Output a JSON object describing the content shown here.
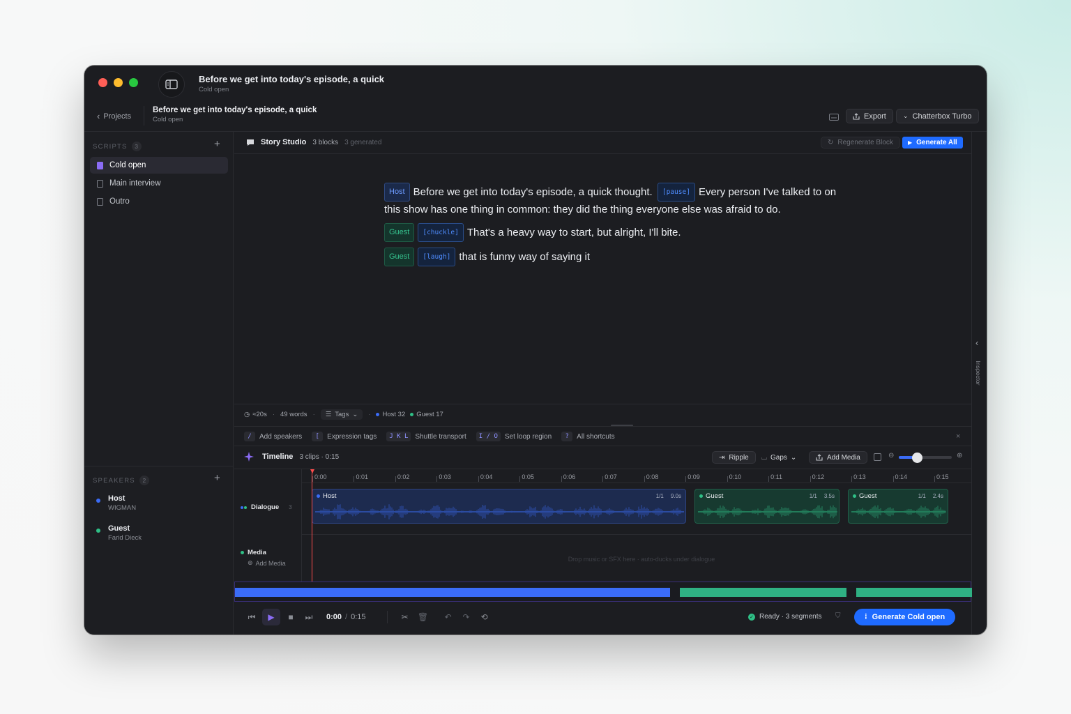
{
  "window": {
    "title": "Before we get into today's episode, a quick",
    "subtitle": "Cold open"
  },
  "header": {
    "back_label": "Projects",
    "title": "Before we get into today's episode, a quick",
    "subtitle": "Cold open",
    "export_label": "Export",
    "model_label": "Chatterbox Turbo"
  },
  "sidebar": {
    "scripts_label": "SCRIPTS",
    "scripts_count": "3",
    "scripts": [
      {
        "label": "Cold open"
      },
      {
        "label": "Main interview"
      },
      {
        "label": "Outro"
      }
    ],
    "speakers_label": "SPEAKERS",
    "speakers_count": "2",
    "speakers": [
      {
        "name": "Host",
        "voice": "WIGMAN",
        "color": "#3b6cf6"
      },
      {
        "name": "Guest",
        "voice": "Farid Dieck",
        "color": "#2fbf86"
      }
    ]
  },
  "studio": {
    "title": "Story Studio",
    "blocks": "3 blocks",
    "generated": "3 generated",
    "regenerate_label": "Regenerate Block",
    "generate_all_label": "Generate All"
  },
  "script_blocks": [
    {
      "speaker": "Host",
      "tag1": "[pause]",
      "text_a": "Before we get into today's episode, a quick thought.",
      "text_b": "Every person I've talked to on this show has one thing in common: they did the thing everyone else was afraid to do."
    },
    {
      "speaker": "Guest",
      "tag1": "[chuckle]",
      "text_a": "That's a heavy way to start, but alright, I'll bite."
    },
    {
      "speaker": "Guest",
      "tag1": "[laugh]",
      "text_a": "that is funny way of saying it"
    }
  ],
  "stats": {
    "duration": "≈20s",
    "words": "49 words",
    "tags_label": "Tags",
    "host_count": "Host 32",
    "guest_count": "Guest 17"
  },
  "shortcuts": [
    {
      "key": "/",
      "label": "Add speakers"
    },
    {
      "key": "[",
      "label": "Expression tags"
    },
    {
      "key": "J K L",
      "label": "Shuttle transport"
    },
    {
      "key": "I / O",
      "label": "Set loop region"
    },
    {
      "key": "?",
      "label": "All shortcuts"
    }
  ],
  "timeline": {
    "title": "Timeline",
    "info": "3 clips · 0:15",
    "ripple_label": "Ripple",
    "gaps_label": "Gaps",
    "add_media_label": "Add Media",
    "zoom_level": 0.25,
    "ticks": [
      "0:00",
      "0:01",
      "0:02",
      "0:03",
      "0:04",
      "0:05",
      "0:06",
      "0:07",
      "0:08",
      "0:09",
      "0:10",
      "0:11",
      "0:12",
      "0:13",
      "0:14",
      "0:15"
    ],
    "dialogue_label": "Dialogue",
    "dialogue_count": "3",
    "media_label": "Media",
    "media_add_label": "Add Media",
    "media_drop_hint": "Drop music or SFX here · auto-ducks under dialogue",
    "clips": [
      {
        "name": "Host",
        "take": "1/1",
        "duration": "9.0s",
        "color": "#3b6cf6"
      },
      {
        "name": "Guest",
        "take": "1/1",
        "duration": "3.5s",
        "color": "#2fbf86"
      },
      {
        "name": "Guest",
        "take": "1/1",
        "duration": "2.4s",
        "color": "#2fbf86"
      }
    ]
  },
  "transport": {
    "current": "0:00",
    "separator": "/",
    "total": "0:15",
    "status": "Ready · 3 segments",
    "generate_label": "Generate Cold open"
  },
  "inspector_label": "Inspector"
}
